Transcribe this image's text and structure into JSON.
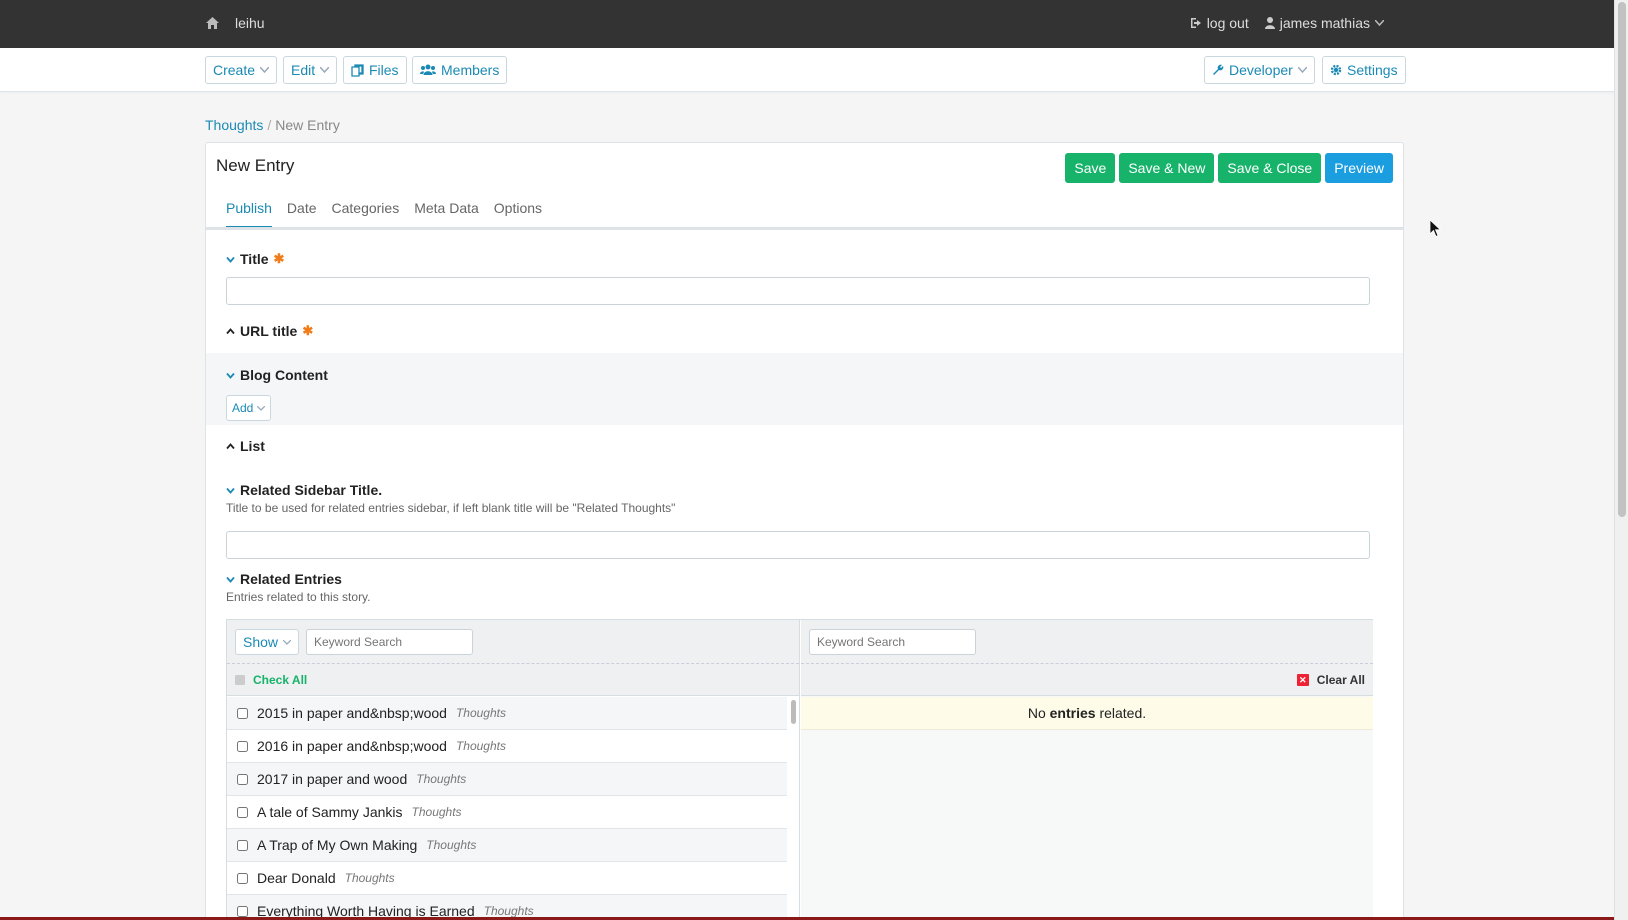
{
  "topbar": {
    "site_name": "leihu",
    "logout": "log out",
    "user": "james mathias"
  },
  "toolbar": {
    "create": "Create",
    "edit": "Edit",
    "files": "Files",
    "members": "Members",
    "developer": "Developer",
    "settings": "Settings"
  },
  "breadcrumb": {
    "parent": "Thoughts",
    "separator": "/",
    "current": "New Entry"
  },
  "panel": {
    "title": "New Entry",
    "actions": {
      "save": "Save",
      "save_new": "Save & New",
      "save_close": "Save & Close",
      "preview": "Preview"
    },
    "tabs": [
      "Publish",
      "Date",
      "Categories",
      "Meta Data",
      "Options"
    ]
  },
  "fields": {
    "title_label": "Title",
    "url_title_label": "URL title",
    "blog_content_label": "Blog Content",
    "add_button": "Add",
    "list_label": "List",
    "sidebar_title_label": "Related Sidebar Title.",
    "sidebar_title_desc": "Title to be used for related entries sidebar, if left blank title will be \"Related Thoughts\"",
    "related_label": "Related Entries",
    "related_desc": "Entries related to this story."
  },
  "related": {
    "show": "Show",
    "keyword_placeholder": "Keyword Search",
    "check_all": "Check All",
    "clear_all": "Clear All",
    "no_entries_prefix": "No ",
    "no_entries_bold": "entries",
    "no_entries_suffix": " related.",
    "entries": [
      {
        "title": "2015 in paper and&nbsp;wood",
        "channel": "Thoughts"
      },
      {
        "title": "2016 in paper and&nbsp;wood",
        "channel": "Thoughts"
      },
      {
        "title": "2017 in paper and wood",
        "channel": "Thoughts"
      },
      {
        "title": "A tale of Sammy Jankis",
        "channel": "Thoughts"
      },
      {
        "title": "A Trap of My Own Making",
        "channel": "Thoughts"
      },
      {
        "title": "Dear Donald",
        "channel": "Thoughts"
      },
      {
        "title": "Everything Worth Having is Earned",
        "channel": "Thoughts"
      }
    ]
  }
}
